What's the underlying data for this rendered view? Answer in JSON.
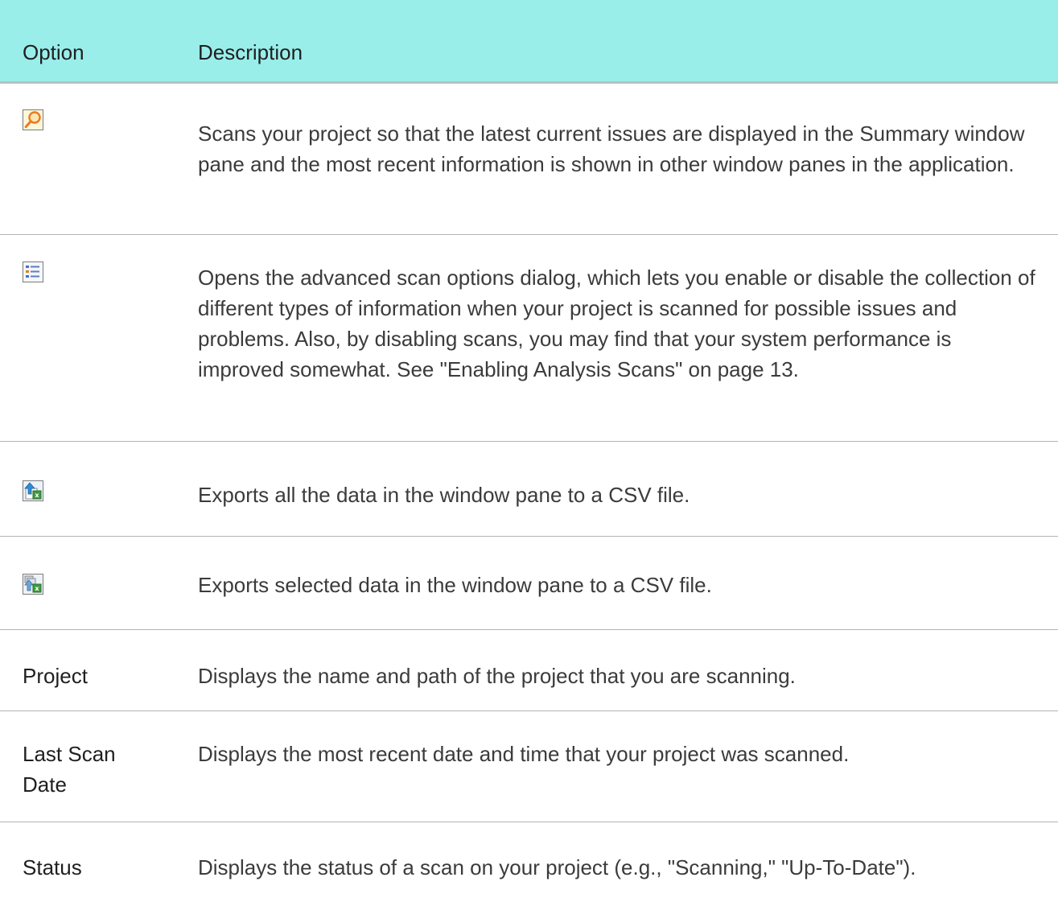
{
  "header": {
    "option_label": "Option",
    "description_label": "Description"
  },
  "rows": [
    {
      "icon": "scan-icon",
      "description": "Scans your project so that the latest current issues are displayed in the Summary window pane and the most recent information is shown in other window panes in the application."
    },
    {
      "icon": "scan-options-icon",
      "description": "Opens the advanced scan options dialog, which lets you enable or disable the collection of different types of information when your project is scanned for possible issues and problems. Also, by disabling scans, you may find that your system performance is improved somewhat. See \"Enabling Analysis Scans\" on page 13."
    },
    {
      "icon": "export-all-csv-icon",
      "description": "Exports all the data in the window pane to a CSV file."
    },
    {
      "icon": "export-selected-csv-icon",
      "description": "Exports selected data in the window pane to a CSV file."
    },
    {
      "option": "Project",
      "description": "Displays the name and path of the project that you are scanning."
    },
    {
      "option": "Last Scan Date",
      "description": "Displays the most recent date and time that your project was scanned."
    },
    {
      "option": "Status",
      "description": "Displays the status of a scan on your project (e.g., \"Scanning,\" \"Up-To-Date\")."
    }
  ]
}
